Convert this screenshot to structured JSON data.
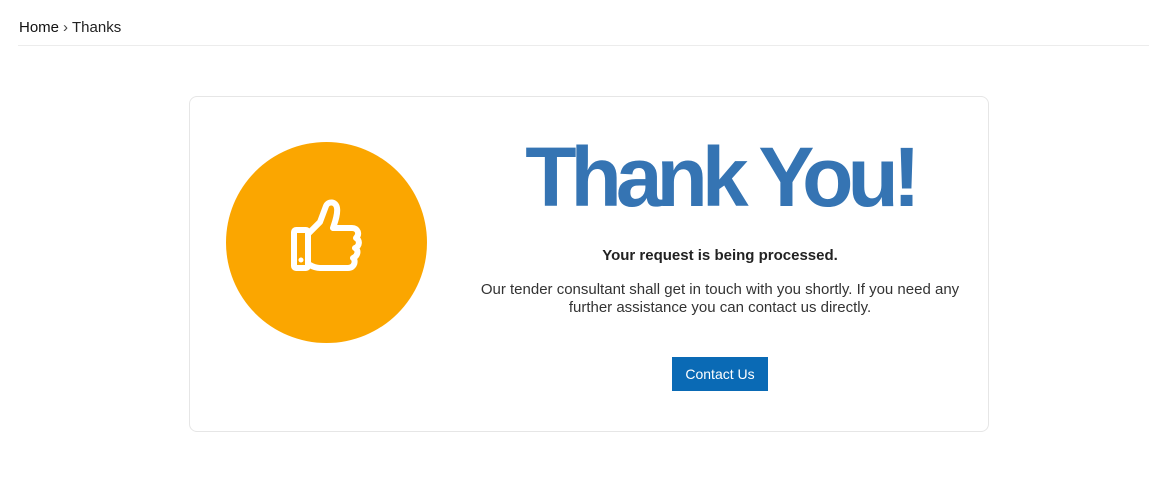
{
  "breadcrumb": {
    "home": "Home",
    "separator": "›",
    "current": "Thanks"
  },
  "main": {
    "icon": "thumbs-up-icon",
    "accent_color": "#fba600",
    "title": "Thank You!",
    "title_color": "#3574b3",
    "subtitle": "Your request is being processed.",
    "message": "Our tender consultant shall get in touch with you shortly. If you need any further assistance you can contact us directly.",
    "button_label": "Contact Us",
    "button_color": "#0a6ab5"
  }
}
